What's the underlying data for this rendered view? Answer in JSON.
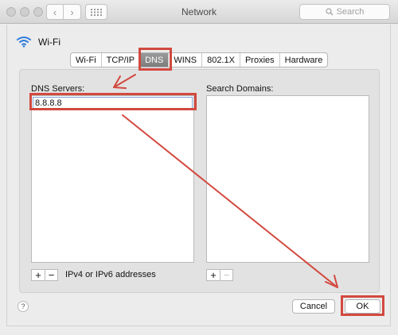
{
  "window": {
    "title": "Network"
  },
  "toolbar": {
    "back_icon": "chevron-left-icon",
    "forward_icon": "chevron-right-icon",
    "grid_icon": "grid-icon",
    "search_placeholder": "Search"
  },
  "interface": {
    "name": "Wi-Fi",
    "icon": "wifi-icon"
  },
  "tabs": [
    {
      "label": "Wi-Fi",
      "active": false
    },
    {
      "label": "TCP/IP",
      "active": false
    },
    {
      "label": "DNS",
      "active": true
    },
    {
      "label": "WINS",
      "active": false
    },
    {
      "label": "802.1X",
      "active": false
    },
    {
      "label": "Proxies",
      "active": false
    },
    {
      "label": "Hardware",
      "active": false
    }
  ],
  "dns": {
    "label": "DNS Servers:",
    "entries": [
      "8.8.8.8"
    ],
    "add": "+",
    "remove": "−",
    "hint": "IPv4 or IPv6 addresses"
  },
  "search_domains": {
    "label": "Search Domains:",
    "add": "+",
    "remove": "−"
  },
  "buttons": {
    "help": "?",
    "cancel": "Cancel",
    "ok": "OK"
  },
  "colors": {
    "annotation": "#d2493f",
    "active_tab": "#8a8a8a",
    "wifi": "#2f7bdc"
  }
}
